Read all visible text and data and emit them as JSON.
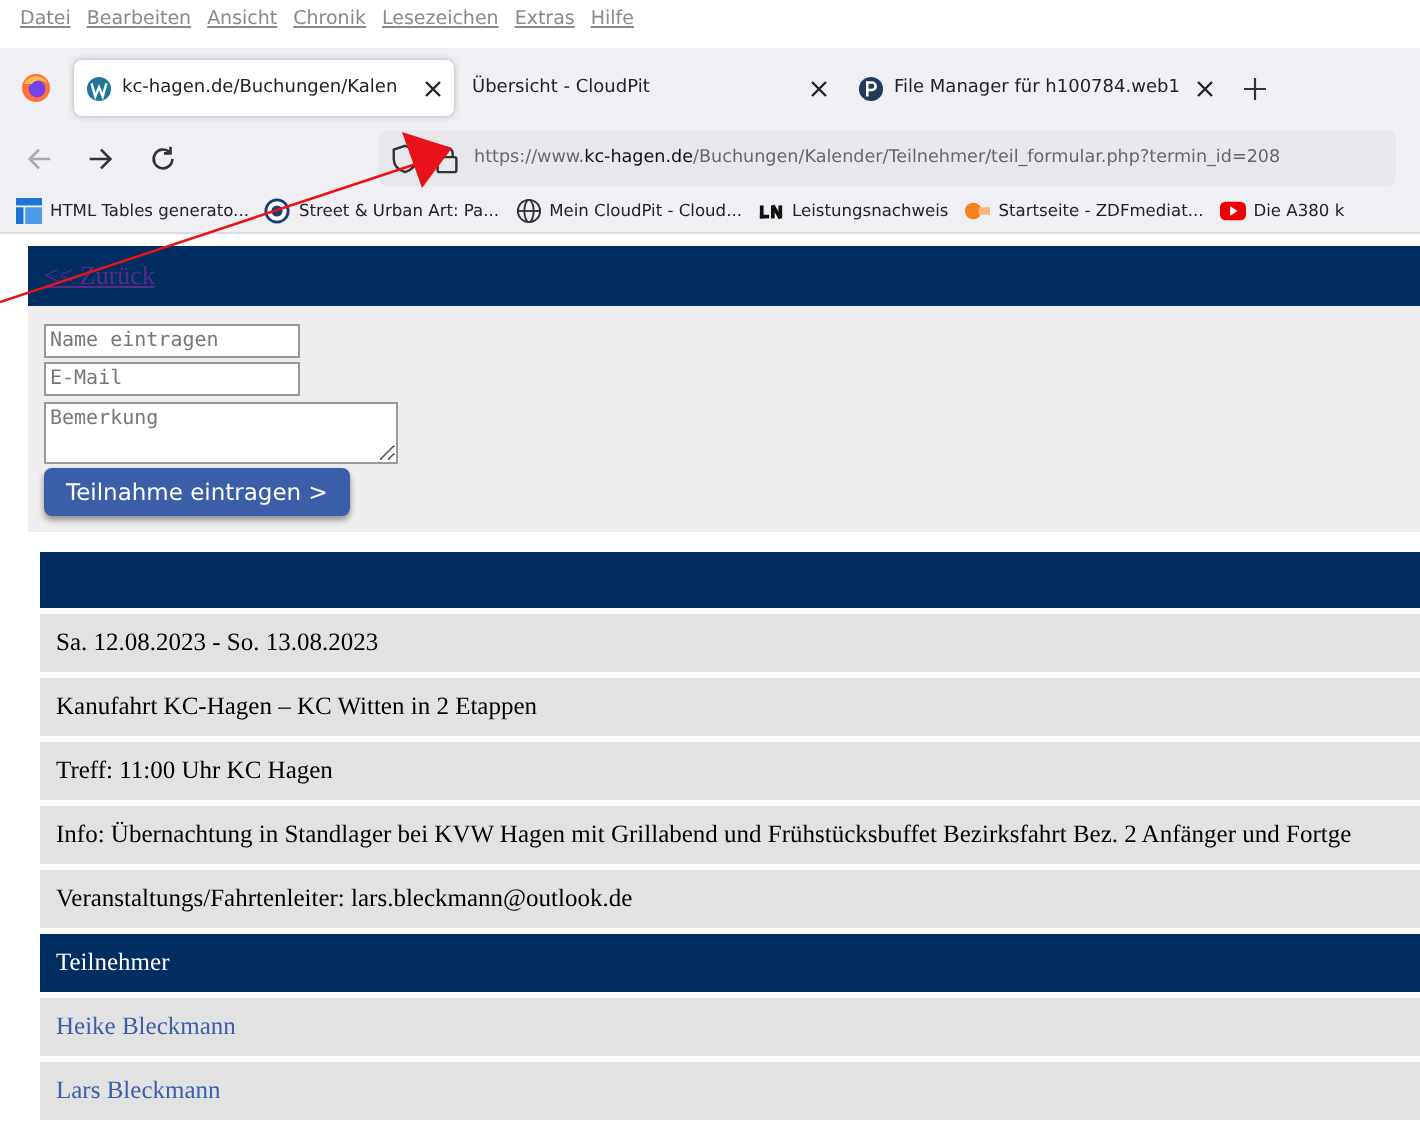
{
  "menu_bar": [
    "Datei",
    "Bearbeiten",
    "Ansicht",
    "Chronik",
    "Lesezeichen",
    "Extras",
    "Hilfe"
  ],
  "tabs": [
    {
      "title": "kc-hagen.de/Buchungen/Kalen",
      "selected": true
    },
    {
      "title": "Übersicht - CloudPit",
      "selected": false
    },
    {
      "title": "File Manager für h100784.web1",
      "selected": false
    }
  ],
  "address_bar": {
    "prefix": "https://www.",
    "domain": "kc-hagen.de",
    "path": "/Buchungen/Kalender/Teilnehmer/teil_formular.php?termin_id=208"
  },
  "bookmarks": [
    "HTML Tables generato...",
    "Street & Urban Art: Pa...",
    "Mein CloudPit - Cloud...",
    "Leistungsnachweis",
    "Startseite - ZDFmediat...",
    "Die A380 k"
  ],
  "page": {
    "back_link": "<< Zurück",
    "form": {
      "name_placeholder": "Name eintragen",
      "email_placeholder": "E-Mail",
      "remark_placeholder": "Bemerkung",
      "submit": "Teilnahme eintragen >"
    },
    "details": [
      "Sa. 12.08.2023 - So. 13.08.2023",
      "Kanufahrt KC-Hagen – KC Witten in 2 Etappen",
      "Treff: 11:00 Uhr KC Hagen",
      "Info: Übernachtung in Standlager bei KVW Hagen mit Grillabend und Frühstücksbuffet Bezirksfahrt Bez. 2 Anfänger und Fortge",
      "Veranstaltungs/Fahrtenleiter: lars.bleckmann@outlook.de"
    ],
    "participants_heading": "Teilnehmer",
    "participants": [
      "Heike Bleckmann",
      "Lars Bleckmann"
    ]
  }
}
